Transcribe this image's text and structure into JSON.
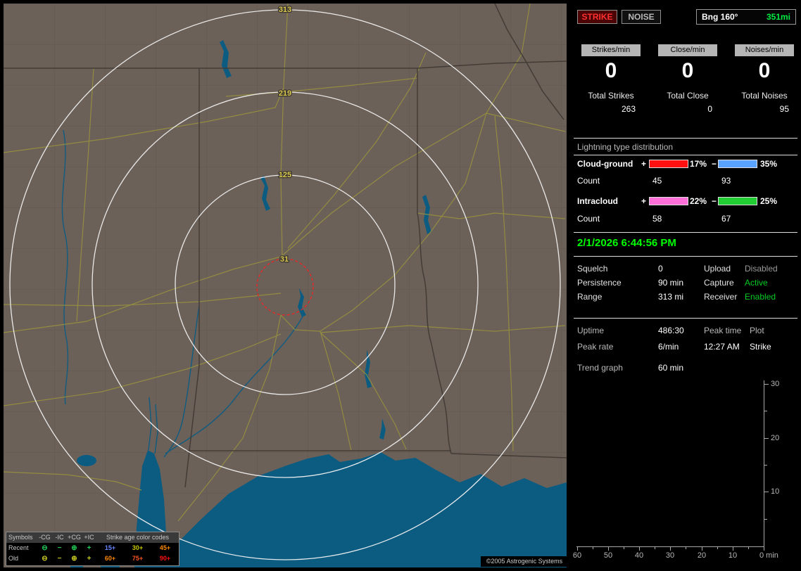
{
  "map": {
    "ring_labels": [
      "313",
      "219",
      "125",
      "31"
    ],
    "copyright": "©2005 Astrogenic Systems",
    "legend": {
      "symbols_header": "Symbols",
      "type_headers": [
        "-CG",
        "-IC",
        "+CG",
        "+IC"
      ],
      "age_header": "Strike age color codes",
      "recent_label": "Recent",
      "old_label": "Old",
      "symbols": [
        "⊖",
        "−",
        "⊕",
        "+"
      ],
      "recent_symbol_color": "#22cc55",
      "old_symbol_color": "#cccc22",
      "recent_ages": [
        {
          "text": "15+",
          "color": "#6688ff"
        },
        {
          "text": "30+",
          "color": "#cccc00"
        },
        {
          "text": "45+",
          "color": "#ff8800"
        }
      ],
      "old_ages": [
        {
          "text": "60+",
          "color": "#ff8800"
        },
        {
          "text": "75+",
          "color": "#ff5522"
        },
        {
          "text": "90+",
          "color": "#ff1111"
        }
      ]
    }
  },
  "panel": {
    "strike_button": "STRIKE",
    "noise_button": "NOISE",
    "bearing": {
      "label": "Bng 160°",
      "value": "351mi",
      "value_color": "#00ee44"
    },
    "counters": [
      {
        "badge": "Strikes/min",
        "value": "0",
        "total_label": "Total Strikes",
        "total_value": "263"
      },
      {
        "badge": "Close/min",
        "value": "0",
        "total_label": "Total Close",
        "total_value": "0"
      },
      {
        "badge": "Noises/min",
        "value": "0",
        "total_label": "Total Noises",
        "total_value": "95"
      }
    ],
    "distribution": {
      "title": "Lightning type distribution",
      "rows": [
        {
          "label": "Cloud-ground",
          "plus": "+",
          "minus": "−",
          "pos_pct": "17%",
          "pos_color": "#ff1111",
          "neg_pct": "35%",
          "neg_color": "#5aa2ff",
          "count_label": "Count",
          "pos_count": "45",
          "neg_count": "93"
        },
        {
          "label": "Intracloud",
          "plus": "+",
          "minus": "−",
          "pos_pct": "22%",
          "pos_color": "#ff6fd8",
          "neg_pct": "25%",
          "neg_color": "#22cc33",
          "count_label": "Count",
          "pos_count": "58",
          "neg_count": "67"
        }
      ]
    },
    "datetime": {
      "text": "2/1/2026 6:44:56 PM",
      "color": "#00ff00"
    },
    "settings": {
      "rows": [
        {
          "label1": "Squelch",
          "value1": "0",
          "label2": "Upload",
          "value2": "Disabled",
          "value2_color": "#9a9a9a"
        },
        {
          "label1": "Persistence",
          "value1": "90 min",
          "label2": "Capture",
          "value2": "Active",
          "value2_color": "#00cc22"
        },
        {
          "label1": "Range",
          "value1": "313 mi",
          "label2": "Receiver",
          "value2": "Enabled",
          "value2_color": "#00cc22"
        }
      ]
    },
    "status": {
      "uptime_label": "Uptime",
      "uptime_value": "486:30",
      "peak_time_label": "Peak time",
      "peak_time_value": "12:27 AM",
      "plot_label": "Plot",
      "plot_value": "Strike",
      "peak_rate_label": "Peak rate",
      "peak_rate_value": "6/min",
      "trend_label": "Trend graph",
      "trend_value": "60 min"
    },
    "trend_chart": {
      "y_ticks": [
        "30",
        "20",
        "10"
      ],
      "x_ticks": [
        "60",
        "50",
        "40",
        "30",
        "20",
        "10"
      ],
      "x_end_label": "0 min"
    }
  }
}
